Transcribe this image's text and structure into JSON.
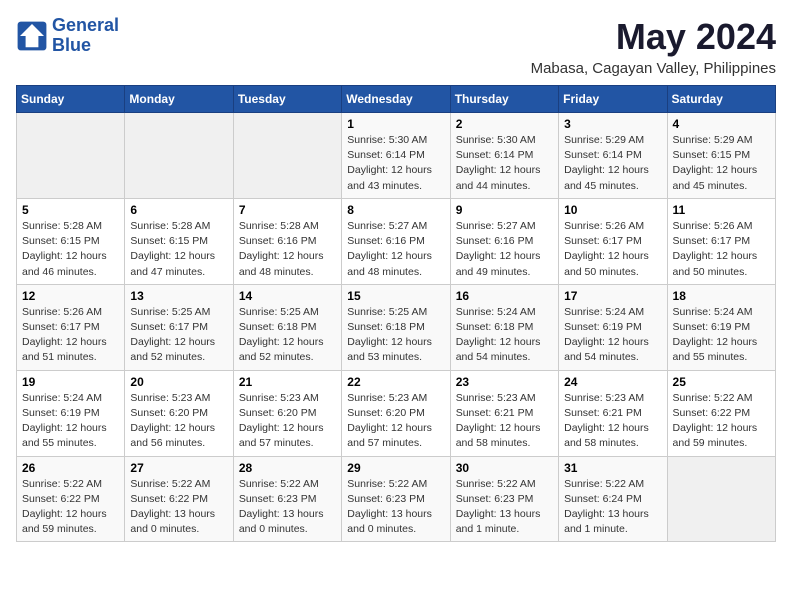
{
  "logo": {
    "line1": "General",
    "line2": "Blue"
  },
  "title": "May 2024",
  "subtitle": "Mabasa, Cagayan Valley, Philippines",
  "days_header": [
    "Sunday",
    "Monday",
    "Tuesday",
    "Wednesday",
    "Thursday",
    "Friday",
    "Saturday"
  ],
  "weeks": [
    [
      {
        "num": "",
        "info": ""
      },
      {
        "num": "",
        "info": ""
      },
      {
        "num": "",
        "info": ""
      },
      {
        "num": "1",
        "info": "Sunrise: 5:30 AM\nSunset: 6:14 PM\nDaylight: 12 hours\nand 43 minutes."
      },
      {
        "num": "2",
        "info": "Sunrise: 5:30 AM\nSunset: 6:14 PM\nDaylight: 12 hours\nand 44 minutes."
      },
      {
        "num": "3",
        "info": "Sunrise: 5:29 AM\nSunset: 6:14 PM\nDaylight: 12 hours\nand 45 minutes."
      },
      {
        "num": "4",
        "info": "Sunrise: 5:29 AM\nSunset: 6:15 PM\nDaylight: 12 hours\nand 45 minutes."
      }
    ],
    [
      {
        "num": "5",
        "info": "Sunrise: 5:28 AM\nSunset: 6:15 PM\nDaylight: 12 hours\nand 46 minutes."
      },
      {
        "num": "6",
        "info": "Sunrise: 5:28 AM\nSunset: 6:15 PM\nDaylight: 12 hours\nand 47 minutes."
      },
      {
        "num": "7",
        "info": "Sunrise: 5:28 AM\nSunset: 6:16 PM\nDaylight: 12 hours\nand 48 minutes."
      },
      {
        "num": "8",
        "info": "Sunrise: 5:27 AM\nSunset: 6:16 PM\nDaylight: 12 hours\nand 48 minutes."
      },
      {
        "num": "9",
        "info": "Sunrise: 5:27 AM\nSunset: 6:16 PM\nDaylight: 12 hours\nand 49 minutes."
      },
      {
        "num": "10",
        "info": "Sunrise: 5:26 AM\nSunset: 6:17 PM\nDaylight: 12 hours\nand 50 minutes."
      },
      {
        "num": "11",
        "info": "Sunrise: 5:26 AM\nSunset: 6:17 PM\nDaylight: 12 hours\nand 50 minutes."
      }
    ],
    [
      {
        "num": "12",
        "info": "Sunrise: 5:26 AM\nSunset: 6:17 PM\nDaylight: 12 hours\nand 51 minutes."
      },
      {
        "num": "13",
        "info": "Sunrise: 5:25 AM\nSunset: 6:17 PM\nDaylight: 12 hours\nand 52 minutes."
      },
      {
        "num": "14",
        "info": "Sunrise: 5:25 AM\nSunset: 6:18 PM\nDaylight: 12 hours\nand 52 minutes."
      },
      {
        "num": "15",
        "info": "Sunrise: 5:25 AM\nSunset: 6:18 PM\nDaylight: 12 hours\nand 53 minutes."
      },
      {
        "num": "16",
        "info": "Sunrise: 5:24 AM\nSunset: 6:18 PM\nDaylight: 12 hours\nand 54 minutes."
      },
      {
        "num": "17",
        "info": "Sunrise: 5:24 AM\nSunset: 6:19 PM\nDaylight: 12 hours\nand 54 minutes."
      },
      {
        "num": "18",
        "info": "Sunrise: 5:24 AM\nSunset: 6:19 PM\nDaylight: 12 hours\nand 55 minutes."
      }
    ],
    [
      {
        "num": "19",
        "info": "Sunrise: 5:24 AM\nSunset: 6:19 PM\nDaylight: 12 hours\nand 55 minutes."
      },
      {
        "num": "20",
        "info": "Sunrise: 5:23 AM\nSunset: 6:20 PM\nDaylight: 12 hours\nand 56 minutes."
      },
      {
        "num": "21",
        "info": "Sunrise: 5:23 AM\nSunset: 6:20 PM\nDaylight: 12 hours\nand 57 minutes."
      },
      {
        "num": "22",
        "info": "Sunrise: 5:23 AM\nSunset: 6:20 PM\nDaylight: 12 hours\nand 57 minutes."
      },
      {
        "num": "23",
        "info": "Sunrise: 5:23 AM\nSunset: 6:21 PM\nDaylight: 12 hours\nand 58 minutes."
      },
      {
        "num": "24",
        "info": "Sunrise: 5:23 AM\nSunset: 6:21 PM\nDaylight: 12 hours\nand 58 minutes."
      },
      {
        "num": "25",
        "info": "Sunrise: 5:22 AM\nSunset: 6:22 PM\nDaylight: 12 hours\nand 59 minutes."
      }
    ],
    [
      {
        "num": "26",
        "info": "Sunrise: 5:22 AM\nSunset: 6:22 PM\nDaylight: 12 hours\nand 59 minutes."
      },
      {
        "num": "27",
        "info": "Sunrise: 5:22 AM\nSunset: 6:22 PM\nDaylight: 13 hours\nand 0 minutes."
      },
      {
        "num": "28",
        "info": "Sunrise: 5:22 AM\nSunset: 6:23 PM\nDaylight: 13 hours\nand 0 minutes."
      },
      {
        "num": "29",
        "info": "Sunrise: 5:22 AM\nSunset: 6:23 PM\nDaylight: 13 hours\nand 0 minutes."
      },
      {
        "num": "30",
        "info": "Sunrise: 5:22 AM\nSunset: 6:23 PM\nDaylight: 13 hours\nand 1 minute."
      },
      {
        "num": "31",
        "info": "Sunrise: 5:22 AM\nSunset: 6:24 PM\nDaylight: 13 hours\nand 1 minute."
      },
      {
        "num": "",
        "info": ""
      }
    ]
  ]
}
